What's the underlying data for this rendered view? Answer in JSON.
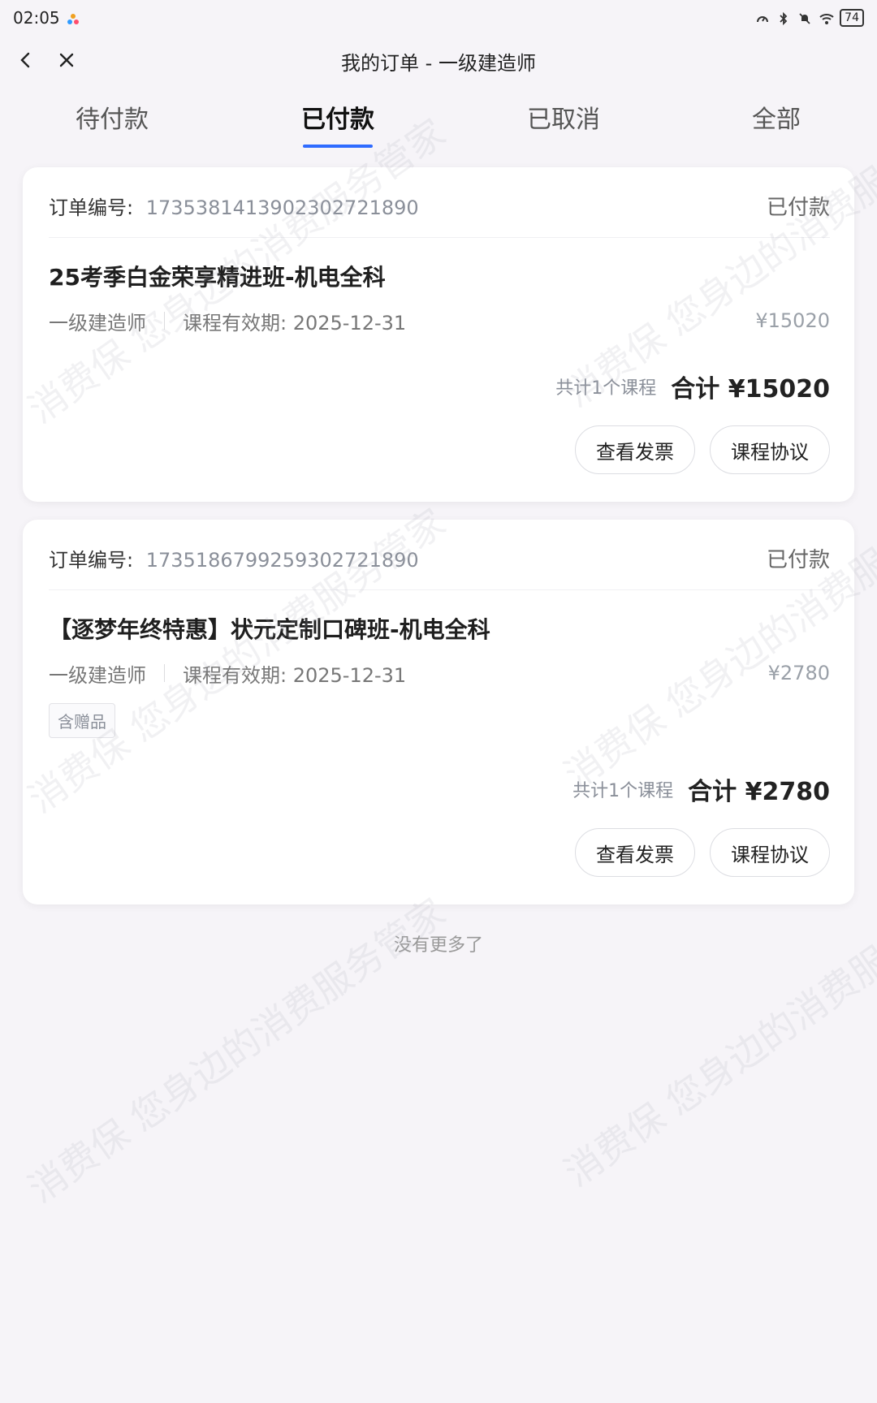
{
  "status_bar": {
    "time": "02:05",
    "battery": "74"
  },
  "header": {
    "title": "我的订单 - 一级建造师"
  },
  "tabs": [
    {
      "label": "待付款"
    },
    {
      "label": "已付款"
    },
    {
      "label": "已取消"
    },
    {
      "label": "全部"
    }
  ],
  "orders": [
    {
      "order_no_label": "订单编号:",
      "order_no": "1735381413902302721890",
      "status": "已付款",
      "course_title": "25考季白金荣享精进班-机电全科",
      "category": "一级建造师",
      "validity": "课程有效期: 2025-12-31",
      "price": "¥15020",
      "total_count": "共计1个课程",
      "total_amount": "合计 ¥15020",
      "btn_invoice": "查看发票",
      "btn_agreement": "课程协议"
    },
    {
      "order_no_label": "订单编号:",
      "order_no": "1735186799259302721890",
      "status": "已付款",
      "course_title": "【逐梦年终特惠】状元定制口碑班-机电全科",
      "category": "一级建造师",
      "validity": "课程有效期: 2025-12-31",
      "price": "¥2780",
      "gift_badge": "含赠品",
      "total_count": "共计1个课程",
      "total_amount": "合计 ¥2780",
      "btn_invoice": "查看发票",
      "btn_agreement": "课程协议"
    }
  ],
  "footer": {
    "no_more": "没有更多了"
  },
  "watermark": {
    "text": "消费保 您身边的消费服务管家"
  },
  "colors": {
    "accent": "#2f6bff",
    "background": "#f6f4f8"
  }
}
